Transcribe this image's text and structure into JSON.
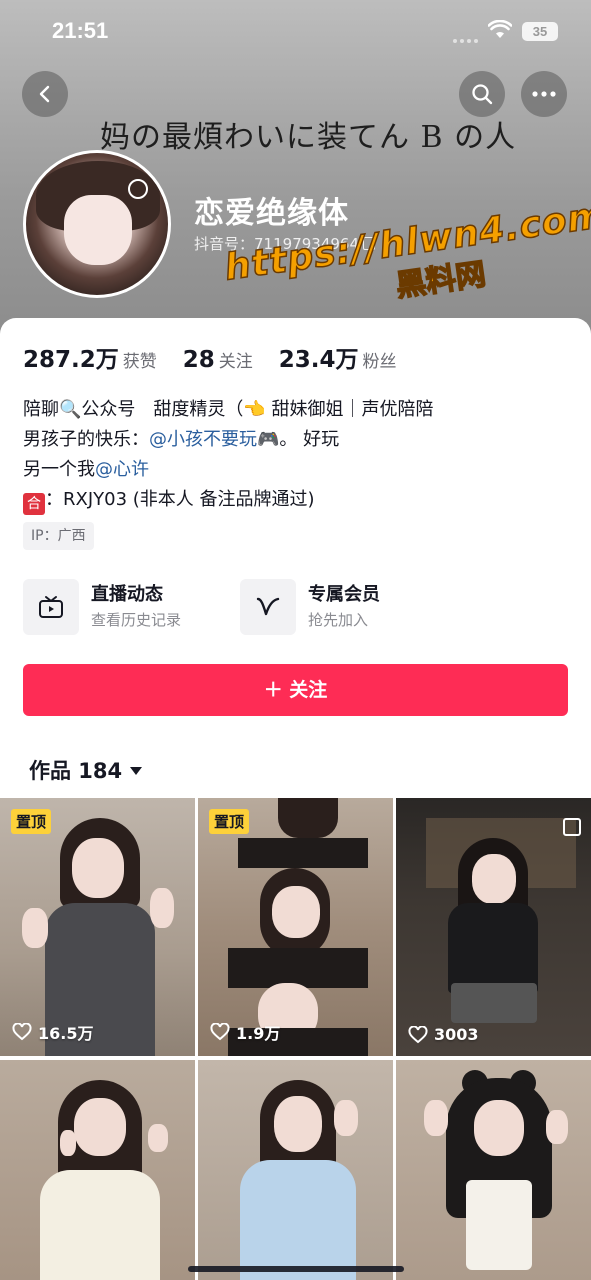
{
  "status": {
    "time": "21:51",
    "battery": "35"
  },
  "nav": {
    "back_icon": "chevron-left-icon",
    "search_icon": "search-icon",
    "more_icon": "more-horizontal-icon"
  },
  "banner": {
    "text": "妈の最煩わいに装てん B の人"
  },
  "profile": {
    "nickname": "恋爱绝缘体",
    "douyin_id_label": "抖音号：",
    "douyin_id": "71197934964"
  },
  "watermark": {
    "url": "https://hlwn4.com",
    "site": "黑料网"
  },
  "stats": [
    {
      "value": "287.2万",
      "label": "获赞"
    },
    {
      "value": "28",
      "label": "关注"
    },
    {
      "value": "23.4万",
      "label": "粉丝"
    }
  ],
  "bio": {
    "line1": "陪聊🔍公众号　甜度精灵（👈 甜妹御姐｜声优陪陪",
    "line2_prefix": "男孩子的快乐：",
    "line2_mention": "@小孩不要玩🎮",
    "line2_suffix": "。 好玩",
    "line3_prefix": "另一个我",
    "line3_mention": "@心许",
    "line4_icon": "🈴",
    "line4_text": "：RXJY03 (非本人 备注品牌通过)"
  },
  "ip_tag": "IP：广西",
  "features": {
    "live": {
      "title": "直播动态",
      "subtitle": "查看历史记录",
      "icon": "tv-icon"
    },
    "member": {
      "title": "专属会员",
      "subtitle": "抢先加入",
      "icon": "v-badge-icon"
    }
  },
  "follow_button": "＋ 关注",
  "works": {
    "label": "作品 184"
  },
  "videos": [
    {
      "pinned": "置顶",
      "likes": "16.5万"
    },
    {
      "pinned": "置顶",
      "likes": "1.9万"
    },
    {
      "pinned": "",
      "likes": "3003"
    },
    {
      "pinned": "",
      "likes": ""
    },
    {
      "pinned": "",
      "likes": ""
    },
    {
      "pinned": "",
      "likes": ""
    }
  ],
  "colors": {
    "accent": "#fe2c55",
    "mention": "#2b5f9e",
    "pin_badge": "#fdd13a"
  }
}
